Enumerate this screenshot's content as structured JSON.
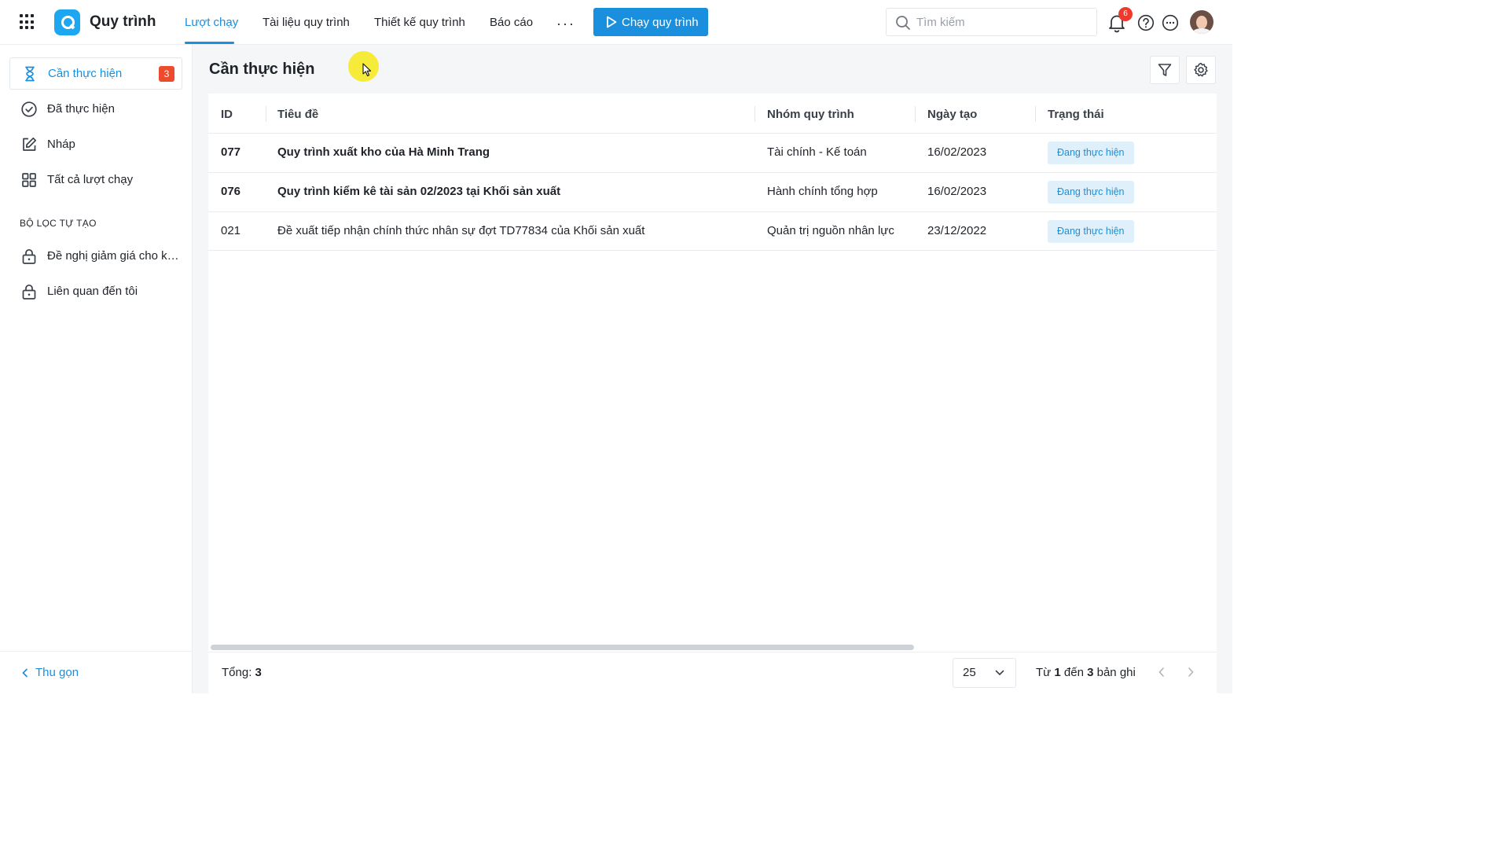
{
  "header": {
    "app_title": "Quy trình",
    "tabs": [
      {
        "label": "Lượt chạy",
        "active": true
      },
      {
        "label": "Tài liệu quy trình",
        "active": false
      },
      {
        "label": "Thiết kế quy trình",
        "active": false
      },
      {
        "label": "Báo cáo",
        "active": false
      }
    ],
    "more_label": "···",
    "run_button_label": "Chạy quy trình",
    "search_placeholder": "Tìm kiếm",
    "notification_count": "6",
    "accent_color": "#1a8fdd",
    "badge_color": "#ec3b2e"
  },
  "sidebar": {
    "items": [
      {
        "label": "Cần thực hiện",
        "icon": "hourglass-icon",
        "badge": "3",
        "active": true
      },
      {
        "label": "Đã thực hiện",
        "icon": "check-circle-icon"
      },
      {
        "label": "Nháp",
        "icon": "edit-icon"
      },
      {
        "label": "Tất cả lượt chạy",
        "icon": "grid-icon"
      }
    ],
    "section_title": "BỘ LỌC TỰ TẠO",
    "filters": [
      {
        "label": "Đề nghị giảm giá cho khá...",
        "icon": "lock-icon"
      },
      {
        "label": "Liên quan đến tôi",
        "icon": "lock-icon"
      }
    ],
    "collapse_label": "Thu gọn"
  },
  "main": {
    "page_title": "Cần thực hiện",
    "columns": [
      "ID",
      "Tiêu đề",
      "Nhóm quy trình",
      "Ngày tạo",
      "Trạng thái"
    ],
    "rows": [
      {
        "id": "077",
        "title": "Quy trình xuất kho của Hà Minh Trang",
        "group": "Tài chính - Kế toán",
        "created": "16/02/2023",
        "status": "Đang thực hiện",
        "bold": true
      },
      {
        "id": "076",
        "title": "Quy trình kiểm kê tài sản 02/2023 tại Khối sản xuất",
        "group": "Hành chính tổng hợp",
        "created": "16/02/2023",
        "status": "Đang thực hiện",
        "bold": true
      },
      {
        "id": "021",
        "title": "Đề xuất tiếp nhận chính thức nhân sự đợt TD77834 của Khối sản xuất",
        "group": "Quản trị nguồn nhân lực",
        "created": "23/12/2022",
        "status": "Đang thực hiện",
        "bold": false
      }
    ],
    "footer": {
      "total_label": "Tổng:",
      "total_value": "3",
      "page_size": "25",
      "range_from_label": "Từ",
      "range_from": "1",
      "range_to_label": "đến",
      "range_to": "3",
      "range_suffix": "bản ghi"
    }
  }
}
